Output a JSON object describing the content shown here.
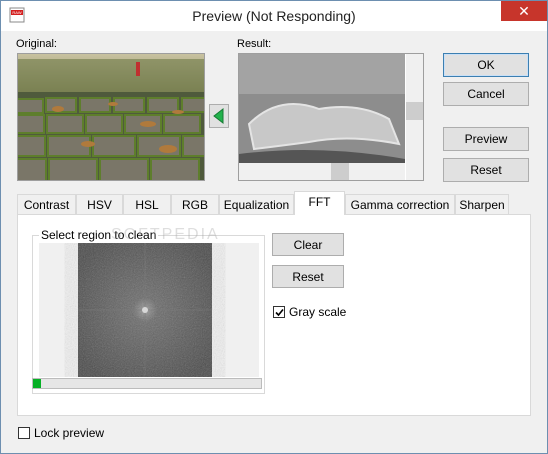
{
  "window": {
    "title": "Preview (Not Responding)",
    "close_label": "✕"
  },
  "labels": {
    "original": "Original:",
    "result": "Result:"
  },
  "buttons": {
    "ok": "OK",
    "cancel": "Cancel",
    "preview": "Preview",
    "reset": "Reset"
  },
  "tabs": [
    "Contrast",
    "HSV",
    "HSL",
    "RGB",
    "Equalization",
    "FFT",
    "Gamma correction",
    "Sharpen"
  ],
  "active_tab": "FFT",
  "fft": {
    "group_label": "Select region to clean",
    "clear_label": "Clear",
    "reset_label": "Reset",
    "grayscale_label": "Gray scale",
    "grayscale_checked": true
  },
  "lock_preview_label": "Lock preview",
  "colors": {
    "progress": "#06b025",
    "accent": "#3c7fb1",
    "close": "#c7352b",
    "arrow": "#22b24c"
  },
  "icons": {
    "arrow": "left-arrow-icon"
  }
}
